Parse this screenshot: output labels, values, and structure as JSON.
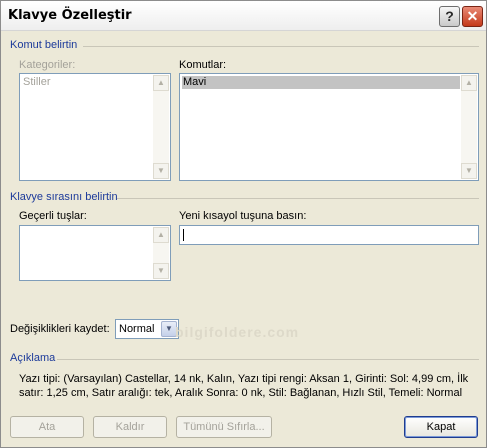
{
  "window": {
    "title": "Klavye Özelleştir",
    "help_label": "?",
    "close_label": "✕"
  },
  "command_section": {
    "title": "Komut belirtin",
    "categories": {
      "label": "Kategoriler:",
      "items": [
        "Stiller"
      ]
    },
    "commands": {
      "label": "Komutlar:",
      "items": [
        "Mavi"
      ]
    }
  },
  "keyboard_section": {
    "title": "Klavye sırasını belirtin",
    "current_keys_label": "Geçerli tuşlar:",
    "new_shortcut_label": "Yeni kısayol tuşuna basın:",
    "new_shortcut_value": ""
  },
  "save_changes": {
    "label": "Değişiklikleri kaydet:",
    "selected": "Normal"
  },
  "watermark": "bilgifoldere.com",
  "description": {
    "title": "Açıklama",
    "text": "Yazı tipi: (Varsayılan) Castellar, 14 nk, Kalın, Yazı tipi rengi: Aksan 1, Girinti: Sol:  4,99 cm, İlk satır:  1,25 cm, Satır aralığı:  tek, Aralık Sonra:  0 nk, Stil: Bağlanan, Hızlı Stil, Temeli: Normal"
  },
  "buttons": {
    "assign": "Ata",
    "remove": "Kaldır",
    "reset_all": "Tümünü Sıfırla...",
    "close": "Kapat"
  },
  "icons": {
    "scroll_up": "▲",
    "scroll_down": "▼",
    "dropdown": "▼"
  }
}
